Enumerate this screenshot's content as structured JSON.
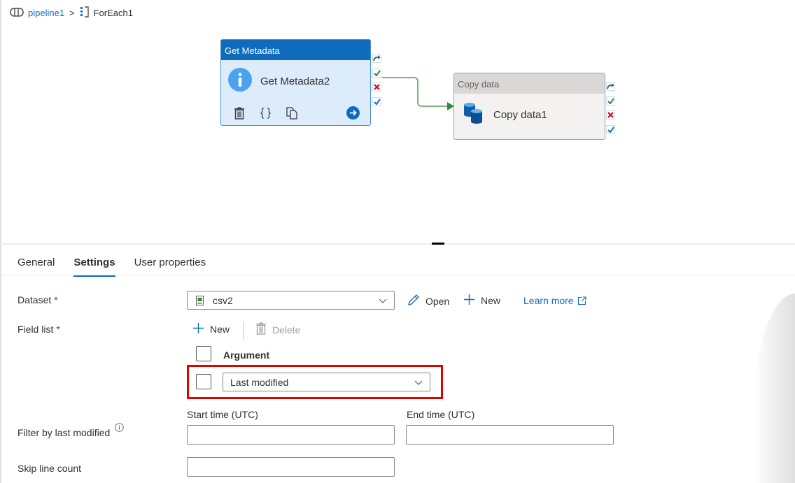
{
  "breadcrumb": {
    "pipeline_label": "pipeline1",
    "separator": ">",
    "current_label": "ForEach1",
    "pipeline_icon": "pipeline-icon",
    "foreach_icon": "foreach-icon"
  },
  "canvas": {
    "activities": [
      {
        "type_label": "Get Metadata",
        "name": "Get Metadata2",
        "icon": "info-icon",
        "tools": [
          "delete-icon",
          "code-icon",
          "copy-icon",
          "go-arrow-icon"
        ],
        "selected": true
      },
      {
        "type_label": "Copy data",
        "name": "Copy data1",
        "icon": "database-copy-icon",
        "selected": false
      }
    ],
    "ports": [
      "skipped",
      "success",
      "failure",
      "completion"
    ],
    "connection": {
      "from": "Get Metadata2",
      "to": "Copy data1",
      "condition": "success"
    },
    "colors": {
      "success": "#2f8a3a",
      "failure": "#c50f1f",
      "completion": "#0f6cbd",
      "skipped": "#605e5c",
      "accent": "#0f6cbd"
    }
  },
  "tabs": [
    {
      "label": "General",
      "active": false
    },
    {
      "label": "Settings",
      "active": true
    },
    {
      "label": "User properties",
      "active": false
    }
  ],
  "settings": {
    "dataset": {
      "label": "Dataset",
      "required_mark": "*",
      "value": "csv2",
      "open_label": "Open",
      "new_label": "New",
      "learn_more_label": "Learn more"
    },
    "field_list": {
      "label": "Field list",
      "required_mark": "*",
      "new_label": "New",
      "delete_label": "Delete",
      "column_header": "Argument",
      "rows": [
        {
          "value": "Last modified",
          "checked": false
        }
      ]
    },
    "filter_last_modified": {
      "label": "Filter by last modified",
      "start_label": "Start time (UTC)",
      "end_label": "End time (UTC)",
      "start_value": "",
      "end_value": ""
    },
    "skip_line_count": {
      "label": "Skip line count",
      "value": ""
    }
  }
}
